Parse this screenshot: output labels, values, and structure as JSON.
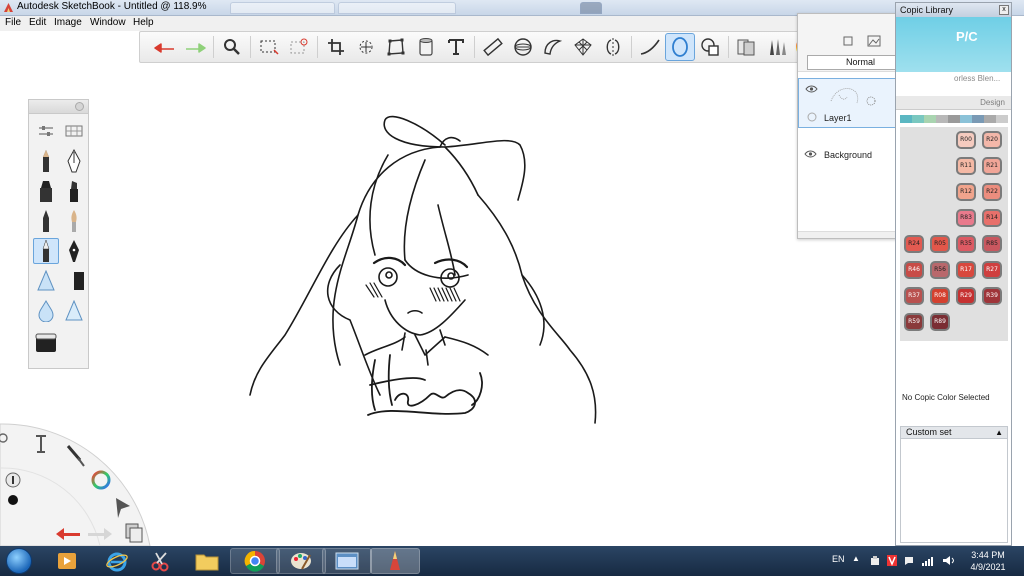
{
  "window": {
    "title": "Autodesk SketchBook - Untitled @ 118.9%"
  },
  "menu": {
    "items": [
      "File",
      "Edit",
      "Image",
      "Window",
      "Help"
    ]
  },
  "toolbar": {
    "tools": [
      "undo",
      "redo",
      "zoom",
      "select",
      "lasso-select",
      "crop",
      "transform",
      "distort",
      "fill",
      "text",
      "ruler",
      "ellipse",
      "french-curve",
      "perspective",
      "symmetry",
      "stroke",
      "predictive-stroke",
      "shape",
      "copic",
      "brush-properties",
      "color-wheel",
      "swatches"
    ],
    "active_tool": "predictive-stroke"
  },
  "layer_editor": {
    "blend_mode": "Normal",
    "opacity": "100",
    "layers": [
      {
        "name": "Layer1",
        "selected": true
      },
      {
        "name": "Background",
        "selected": false
      }
    ]
  },
  "copic_library": {
    "title": "Copic Library",
    "logo": "P/C",
    "blender_label": "orless Blen...",
    "tab_label": "Design",
    "no_selection_text": "No Copic Color Selected",
    "custom_set_label": "Custom set",
    "swatches": [
      {
        "code": "R00",
        "color": "#f5cbbf"
      },
      {
        "code": "R20",
        "color": "#f3b7a9"
      },
      {
        "code": "R11",
        "color": "#f4b9a5"
      },
      {
        "code": "R21",
        "color": "#f0a597"
      },
      {
        "code": "R12",
        "color": "#f1a48c"
      },
      {
        "code": "R22",
        "color": "#ec8d7e"
      },
      {
        "code": "R83",
        "color": "#e97a8c"
      },
      {
        "code": "R14",
        "color": "#e8706b"
      },
      {
        "code": "R24",
        "color": "#e35a51"
      },
      {
        "code": "R05",
        "color": "#e2574a"
      },
      {
        "code": "R35",
        "color": "#dd5a63"
      },
      {
        "code": "R85",
        "color": "#c9575f"
      },
      {
        "code": "R46",
        "color": "#c84c47"
      },
      {
        "code": "R56",
        "color": "#b9686c"
      },
      {
        "code": "R17",
        "color": "#d9483d"
      },
      {
        "code": "R27",
        "color": "#cf3f3f"
      },
      {
        "code": "R37",
        "color": "#b9514f"
      },
      {
        "code": "R08",
        "color": "#d4402f"
      },
      {
        "code": "R29",
        "color": "#c63131"
      },
      {
        "code": "R39",
        "color": "#9f3439"
      },
      {
        "code": "R59",
        "color": "#8a3a3b"
      },
      {
        "code": "R89",
        "color": "#7a2d33"
      }
    ]
  },
  "taskbar": {
    "language": "EN",
    "time": "3:44 PM",
    "date": "4/9/2021"
  },
  "colors": {
    "accent": "#3c8ee6",
    "selection": "#cfe5fb",
    "copic_band": "#6fcfe6"
  }
}
